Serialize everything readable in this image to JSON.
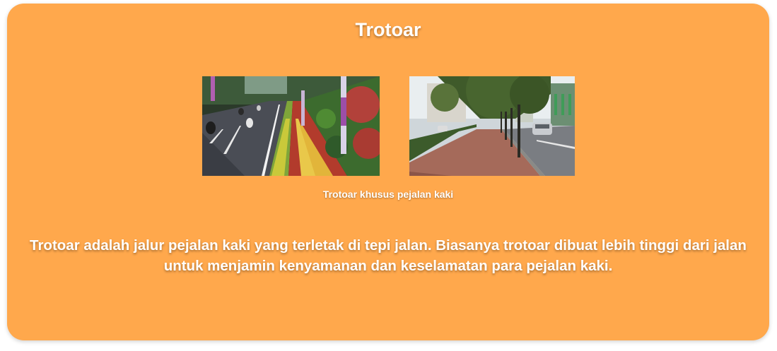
{
  "card": {
    "title": "Trotoar",
    "caption": "Trotoar khusus pejalan kaki",
    "description": "Trotoar adalah jalur pejalan kaki yang terletak di tepi jalan. Biasanya trotoar dibuat lebih tinggi dari jalan untuk menjamin kenyamanan dan keselamatan para pejalan kaki."
  },
  "colors": {
    "card_background": "#ffa84c",
    "text": "#ffffff"
  }
}
